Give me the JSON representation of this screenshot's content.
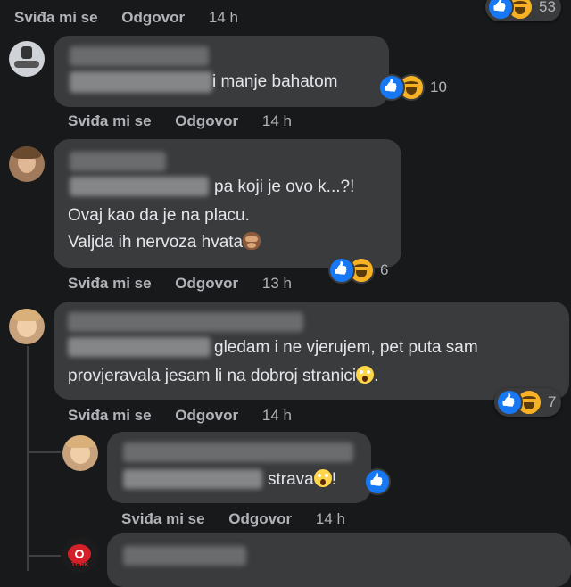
{
  "labels": {
    "like": "Sviđa mi se",
    "reply": "Odgovor"
  },
  "top_partial": {
    "time": "14 h",
    "reaction_count": "53"
  },
  "comments": [
    {
      "text": "i manje bahatom",
      "time": "14 h",
      "reaction_count": "10"
    },
    {
      "line1": "pa koji je ovo k...?!",
      "line2": "Ovaj kao da je na placu.",
      "line3": "Valjda ih nervoza hvata",
      "time": "13 h",
      "reaction_count": "6"
    },
    {
      "line1": "gledam i ne vjerujem, pet puta sam",
      "line2": "provjeravala jesam li na dobroj stranici",
      "line2_end": ".",
      "time": "14 h",
      "reaction_count": "7"
    }
  ],
  "replies": [
    {
      "text": "strava",
      "text_end": "!",
      "time": "14 h"
    },
    {
      "avatar_caption": "TURK"
    }
  ],
  "colors": {
    "background": "#18191a",
    "bubble": "#3a3b3c",
    "text": "#e4e6eb",
    "secondary_text": "#b0b3b8",
    "like_blue": "#1877f2",
    "haha_yellow": "#f7b125"
  }
}
